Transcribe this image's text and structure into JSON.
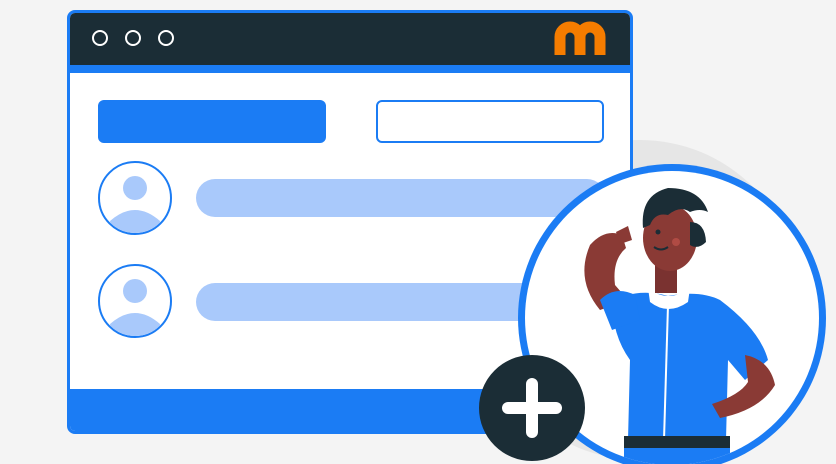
{
  "window": {
    "title_dots": [
      "dot-1",
      "dot-2",
      "dot-3"
    ],
    "logo_glyph": "m"
  },
  "toolbar": {
    "primary_button": "",
    "outline_button": ""
  },
  "list": {
    "rows": [
      {
        "avatar_icon": "user-icon",
        "placeholder": ""
      },
      {
        "avatar_icon": "user-icon",
        "placeholder": ""
      }
    ]
  },
  "add_button": {
    "icon": "plus-icon"
  },
  "illustration": {
    "subject": "person-thinking"
  },
  "colors": {
    "accent": "#1b7cf4",
    "titlebar": "#1b2d36",
    "logo": "#f57c00",
    "placeholder_bar": "#a9c9fb",
    "background": "#f4f4f4"
  }
}
